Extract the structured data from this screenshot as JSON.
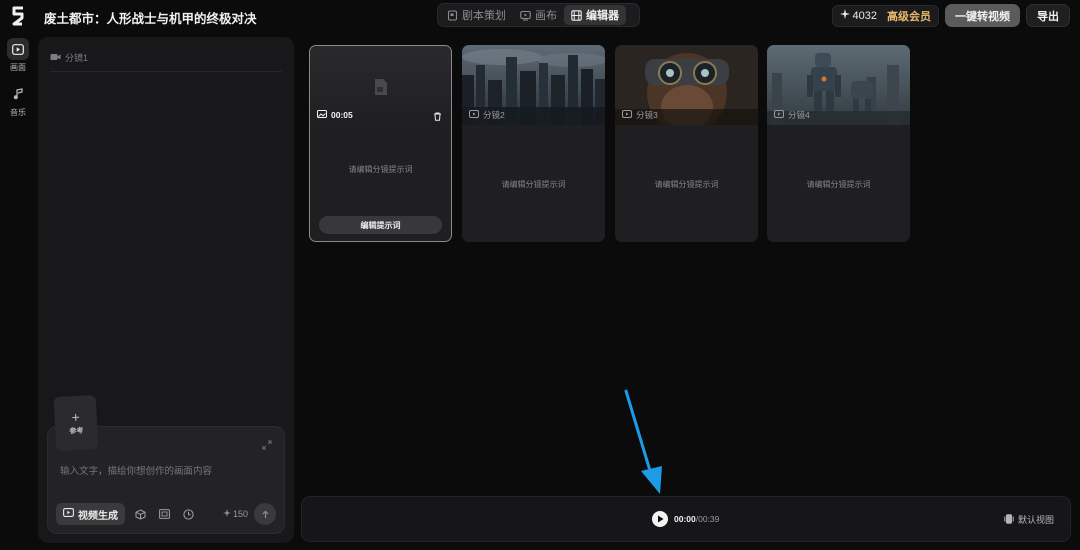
{
  "app": {
    "project_title": "废土都市：人形战士与机甲的终极对决"
  },
  "tabs": [
    {
      "label": "剧本策划",
      "icon": "script-icon"
    },
    {
      "label": "画布",
      "icon": "canvas-icon"
    },
    {
      "label": "编辑器",
      "icon": "film-editor-icon",
      "active": true
    }
  ],
  "header": {
    "credits": "4032",
    "membership": "高级会员",
    "convert_label": "一键转视频",
    "export_label": "导出"
  },
  "rail": [
    {
      "label": "画面",
      "icon": "video-frame-icon",
      "active": true
    },
    {
      "label": "音乐",
      "icon": "music-note-icon",
      "active": false
    }
  ],
  "left_panel": {
    "shot_title": "分镜1",
    "reference_label": "参考",
    "prompt_placeholder": "输入文字，描绘你想创作的画面内容",
    "mode_label": "视频生成",
    "cost": "150"
  },
  "cards": [
    {
      "label": "00:05",
      "hint": "请编辑分镜提示词",
      "button": "编辑提示词",
      "selected": true
    },
    {
      "label": "分镜2",
      "hint": "请编辑分镜提示词",
      "scene": "ruined city skyline"
    },
    {
      "label": "分镜3",
      "hint": "请编辑分镜提示词",
      "scene": "warrior with goggles"
    },
    {
      "label": "分镜4",
      "hint": "请编辑分镜提示词",
      "scene": "mech robots in ruins"
    }
  ],
  "player": {
    "current": "00:00",
    "total": "/00:39",
    "view_label": "默认视图"
  },
  "colors": {
    "background": "#0b0b0c",
    "panel": "#18181a",
    "vip_gold": "#e8b96a",
    "annotation_arrow": "#1e9be6"
  }
}
